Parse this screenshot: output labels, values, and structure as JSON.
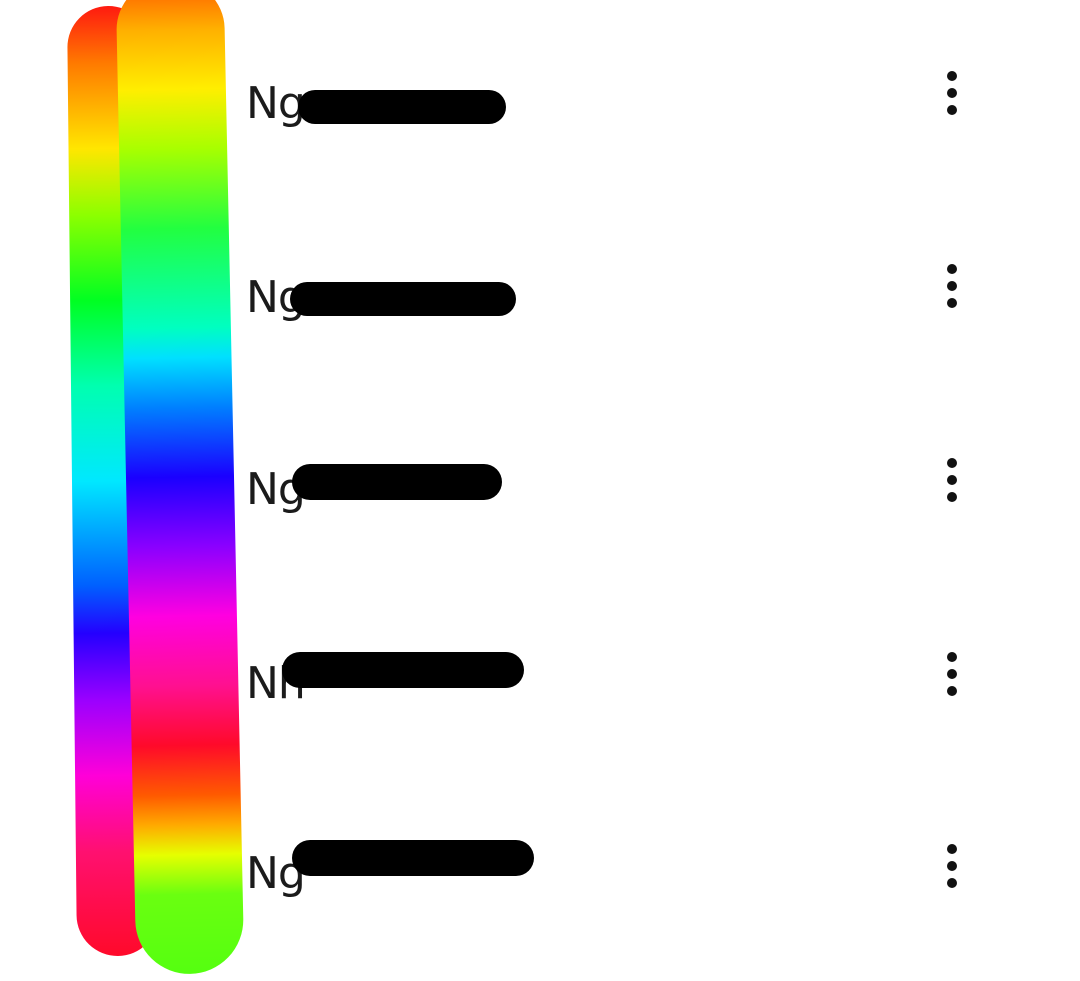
{
  "contacts": [
    {
      "name": "Ng",
      "more_icon": "more-vert-icon"
    },
    {
      "name": "Ng",
      "more_icon": "more-vert-icon"
    },
    {
      "name": "Ng",
      "more_icon": "more-vert-icon"
    },
    {
      "name": "Nh",
      "more_icon": "more-vert-icon"
    },
    {
      "name": "Ng",
      "more_icon": "more-vert-icon"
    }
  ],
  "colors": {
    "background": "#ffffff",
    "text": "#1b1b1b",
    "redaction": "#000000"
  }
}
